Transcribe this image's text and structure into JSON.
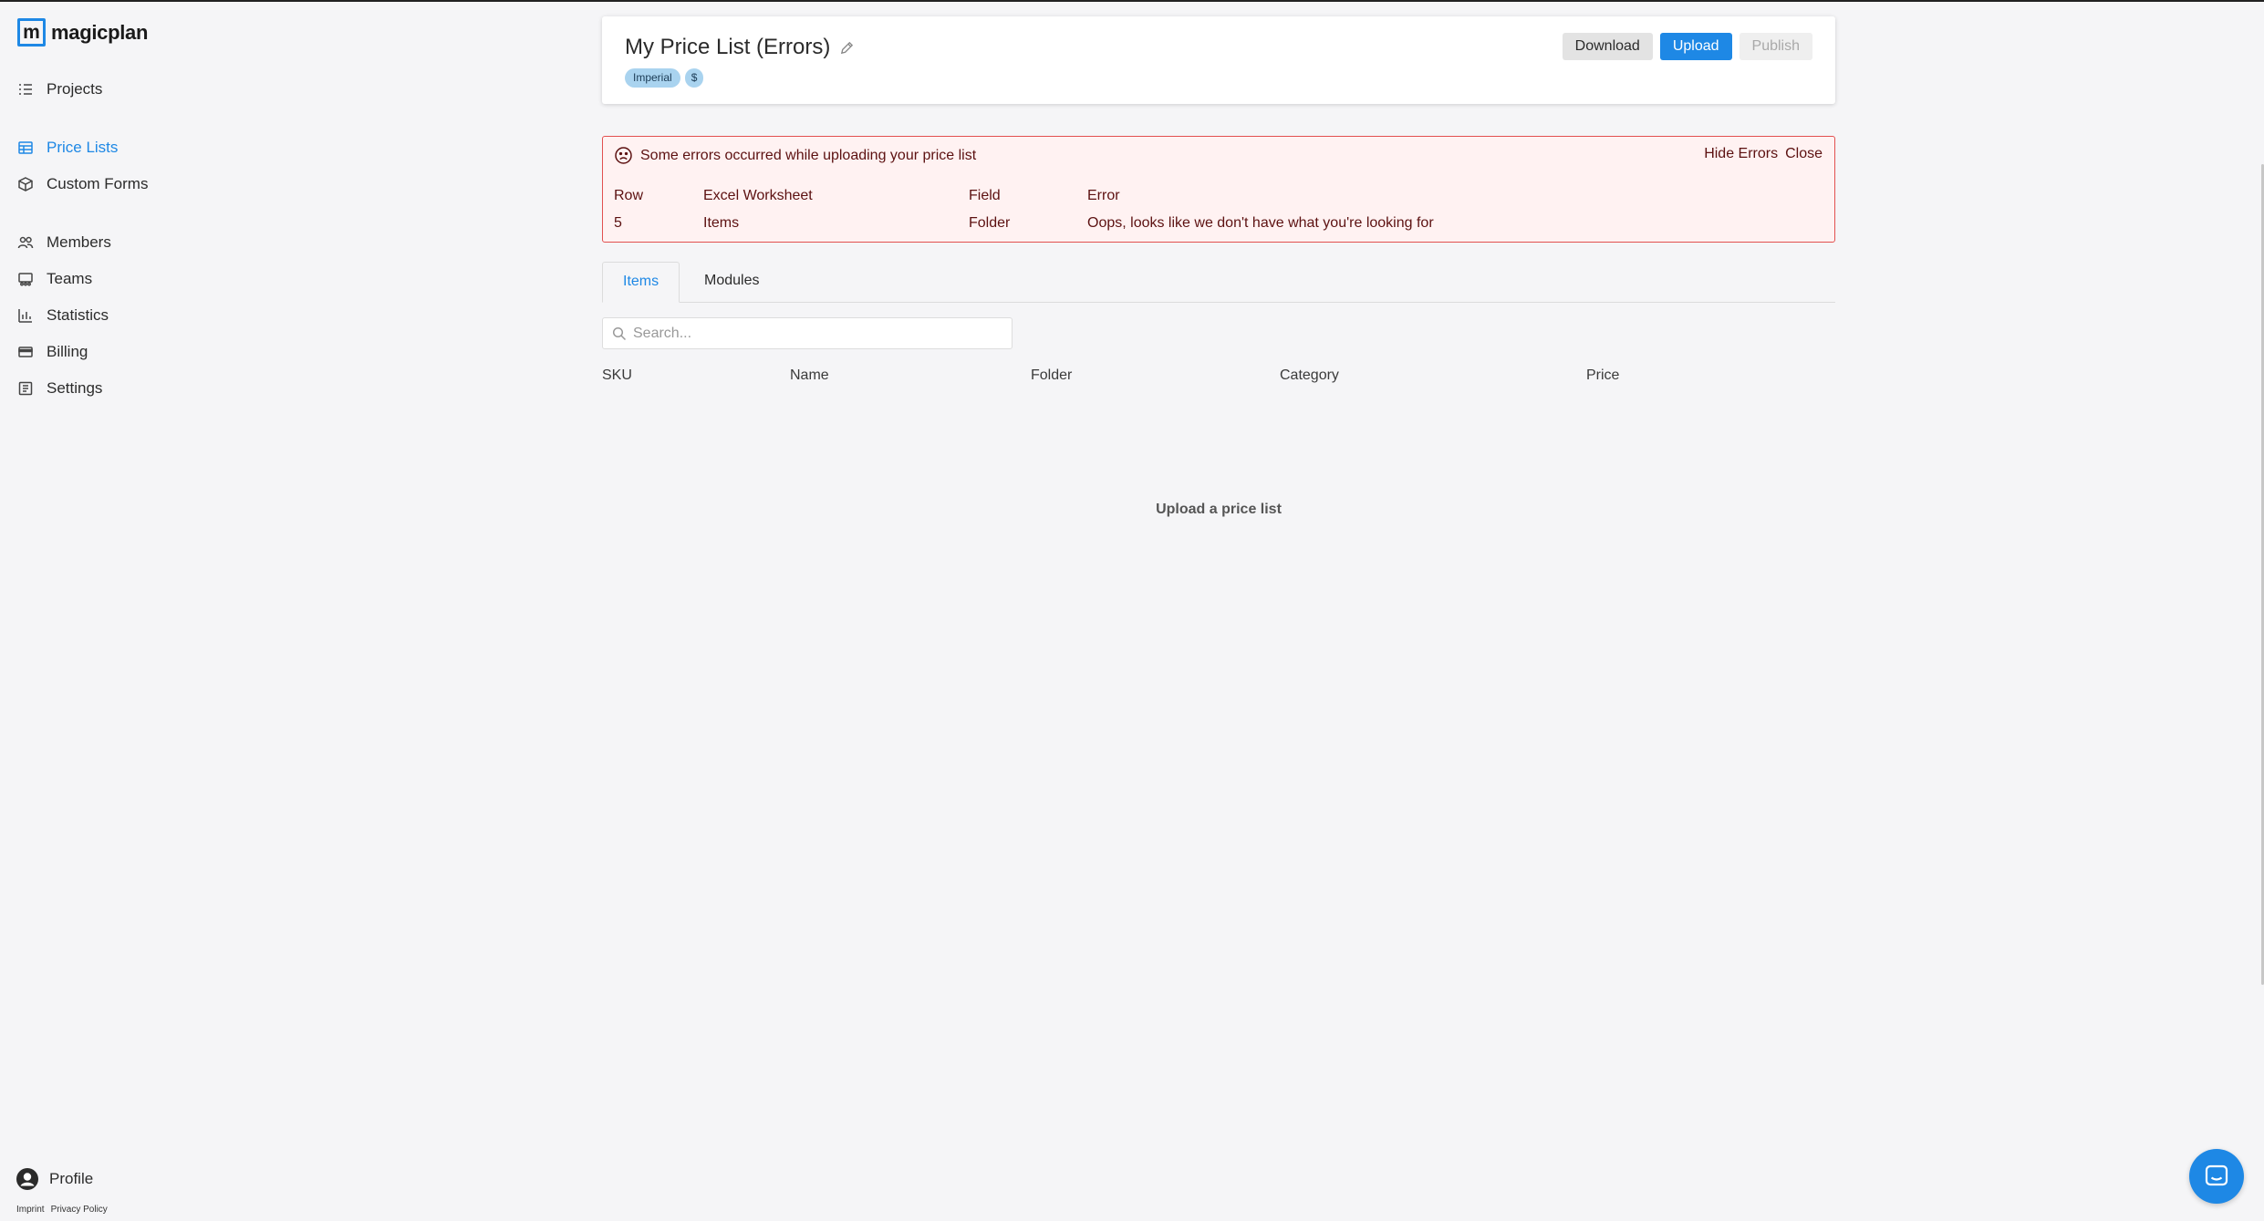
{
  "brand": {
    "logo_letter": "m",
    "name": "magicplan",
    "accent": "#1e88e5"
  },
  "sidebar": {
    "items": [
      {
        "label": "Projects",
        "icon": "list-icon",
        "active": false
      },
      {
        "label": "Price Lists",
        "icon": "table-icon",
        "active": true
      },
      {
        "label": "Custom Forms",
        "icon": "cube-icon",
        "active": false
      },
      {
        "label": "Members",
        "icon": "users-icon",
        "active": false
      },
      {
        "label": "Teams",
        "icon": "team-icon",
        "active": false
      },
      {
        "label": "Statistics",
        "icon": "bar-chart-icon",
        "active": false
      },
      {
        "label": "Billing",
        "icon": "credit-card-icon",
        "active": false
      },
      {
        "label": "Settings",
        "icon": "settings-icon",
        "active": false
      }
    ],
    "profile_label": "Profile",
    "footer": {
      "imprint": "Imprint",
      "privacy": "Privacy Policy"
    }
  },
  "header": {
    "title": "My Price List (Errors)",
    "tags": [
      "Imperial",
      "$"
    ],
    "buttons": {
      "download": "Download",
      "upload": "Upload",
      "publish": "Publish"
    }
  },
  "errors": {
    "message": "Some errors occurred while uploading your price list",
    "hide_label": "Hide Errors",
    "close_label": "Close",
    "columns": [
      "Row",
      "Excel Worksheet",
      "Field",
      "Error"
    ],
    "rows": [
      [
        "5",
        "Items",
        "Folder",
        "Oops, looks like we don't have what you're looking for"
      ]
    ]
  },
  "tabs": [
    {
      "label": "Items",
      "active": true
    },
    {
      "label": "Modules",
      "active": false
    }
  ],
  "search": {
    "placeholder": "Search..."
  },
  "table": {
    "columns": [
      "SKU",
      "Name",
      "Folder",
      "Category",
      "Price"
    ],
    "empty_message": "Upload a price list"
  }
}
